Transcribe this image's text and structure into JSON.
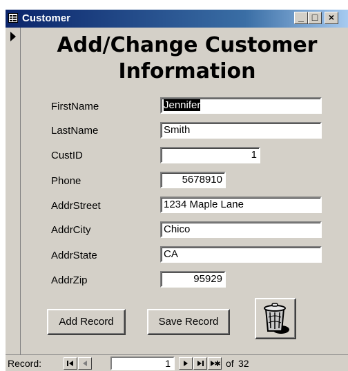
{
  "window": {
    "title": "Customer",
    "minimize": "_",
    "maximize": "□",
    "close": "×"
  },
  "heading": {
    "line1": "Add/Change Customer",
    "line2": "Information"
  },
  "fields": {
    "first_name": {
      "label": "FirstName",
      "value": "Jennifer"
    },
    "last_name": {
      "label": "LastName",
      "value": "Smith"
    },
    "cust_id": {
      "label": "CustID",
      "value": "1"
    },
    "phone": {
      "label": "Phone",
      "value": "5678910"
    },
    "addr_street": {
      "label": "AddrStreet",
      "value": "1234 Maple Lane"
    },
    "addr_city": {
      "label": "AddrCity",
      "value": "Chico"
    },
    "addr_state": {
      "label": "AddrState",
      "value": "CA"
    },
    "addr_zip": {
      "label": "AddrZip",
      "value": "95929"
    }
  },
  "buttons": {
    "add_record": "Add Record",
    "save_record": "Save Record",
    "delete_icon": "trash-can-icon"
  },
  "navigation": {
    "label": "Record:",
    "current": "1",
    "of_label": "of",
    "total": "32"
  }
}
